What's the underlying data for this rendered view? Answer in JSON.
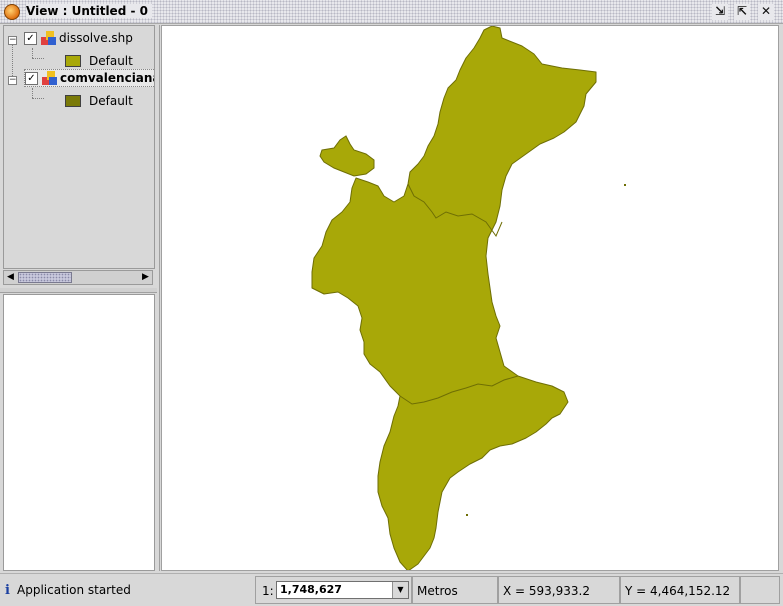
{
  "window": {
    "title": "View : Untitled - 0",
    "buttons": {
      "minimize": "⇲",
      "maximize": "⇱",
      "close": "✕"
    }
  },
  "toc": {
    "layers": [
      {
        "name": "dissolve.shp",
        "checked": true,
        "bold": false,
        "legend_label": "Default",
        "legend_color": "#a8a808"
      },
      {
        "name": "comvalenciana",
        "checked": true,
        "bold": true,
        "legend_label": "Default",
        "legend_color": "#7a7a08"
      }
    ],
    "checkmark": "✓",
    "expand_symbol": "−"
  },
  "scrollbar": {
    "left_arrow": "◀",
    "right_arrow": "▶"
  },
  "map": {
    "fill_color": "#a8a808",
    "stroke_color": "#6e6e04"
  },
  "status": {
    "info_icon": "i",
    "message": "Application started",
    "scale_prefix": "1:",
    "scale_value": "1,748,627",
    "scale_arrow": "▼",
    "units": "Metros",
    "x_coord": "X = 593,933.2",
    "y_coord": "Y = 4,464,152.12"
  }
}
